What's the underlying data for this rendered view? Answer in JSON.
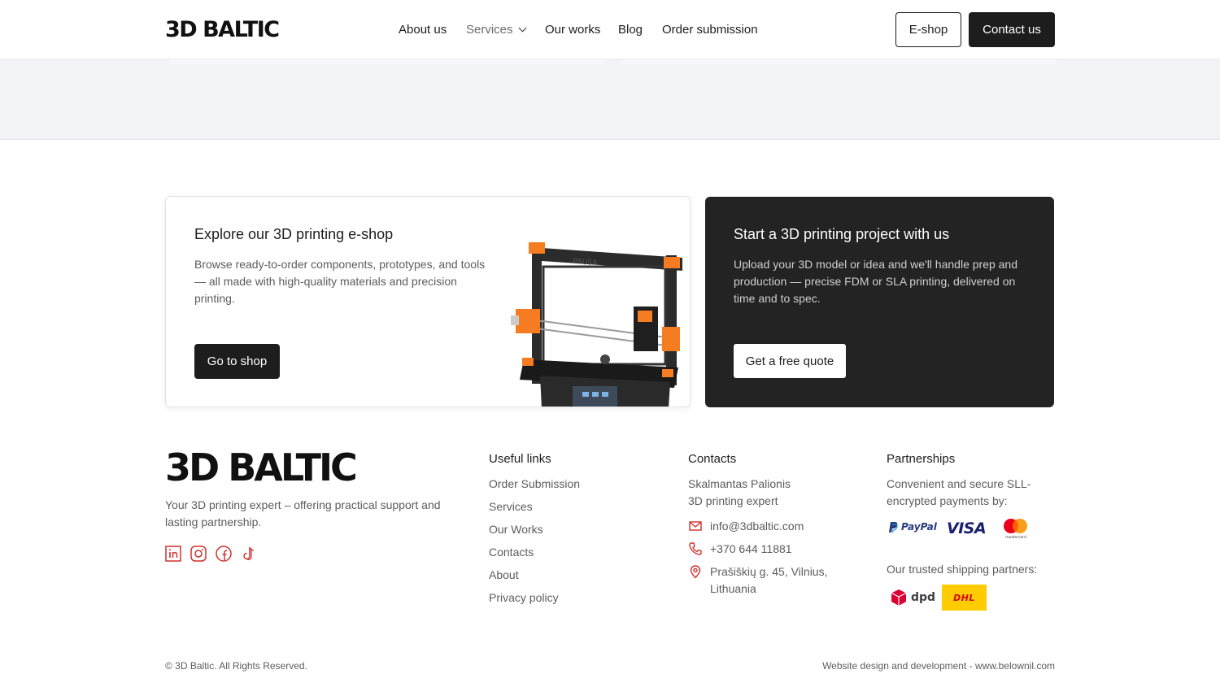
{
  "header": {
    "logo": "3D BALTIC",
    "nav": [
      {
        "label": "About us"
      },
      {
        "label": "Services"
      },
      {
        "label": "Our works"
      },
      {
        "label": "Blog"
      },
      {
        "label": "Order submission"
      }
    ],
    "eshop_label": "E-shop",
    "contact_label": "Contact us"
  },
  "cards": {
    "shop": {
      "title": "Explore our 3D printing e-shop",
      "text": "Browse ready-to-order components, prototypes, and tools — all made with high-quality materials and precision printing.",
      "button": "Go to shop"
    },
    "project": {
      "title": "Start a 3D printing project with us",
      "text": "Upload your 3D model or idea and we'll handle prep and production — precise FDM or SLA printing, delivered on time and to spec.",
      "button": "Get a free quote"
    }
  },
  "footer": {
    "logo": "3D BALTIC",
    "tagline": "Your 3D printing expert – offering practical support and lasting partnership.",
    "socials": [
      "linkedin-icon",
      "instagram-icon",
      "facebook-icon",
      "tiktok-icon"
    ],
    "useful_links": {
      "heading": "Useful links",
      "items": [
        "Order Submission",
        "Services",
        "Our Works",
        "Contacts",
        "About",
        "Privacy policy"
      ]
    },
    "contacts": {
      "heading": "Contacts",
      "name": "Skalmantas Palionis",
      "role": "3D printing expert",
      "email": "info@3dbaltic.com",
      "phone": "+370 644 11881",
      "address": "Prašiškių g. 45, Vilnius, Lithuania"
    },
    "partnerships": {
      "heading": "Partnerships",
      "payments_text": "Convenient and secure SLL-encrypted payments by:",
      "payment_logos": [
        "PayPal",
        "VISA",
        "mastercard"
      ],
      "shipping_text": "Our trusted shipping partners:",
      "shipping_logos": [
        "dpd",
        "DHL"
      ]
    },
    "copyright": "© 3D Baltic. All Rights Reserved.",
    "credits": "Website design and development - www.belownil.com"
  },
  "colors": {
    "dark": "#232323",
    "accent_red": "#d0312d",
    "grey_band": "#f2f3f5"
  }
}
